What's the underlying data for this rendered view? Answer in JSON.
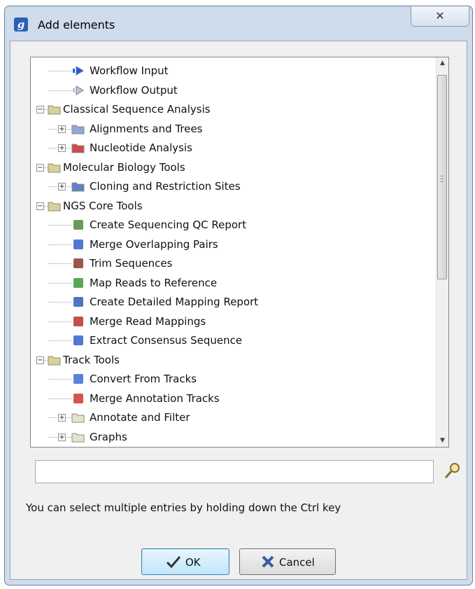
{
  "window": {
    "title": "Add elements",
    "close_glyph": "✕",
    "app_icon_glyph": "g"
  },
  "tree": {
    "rows": [
      {
        "label": "Workflow Input",
        "icon": "workflow-input-icon",
        "level": 1,
        "expander": null
      },
      {
        "label": "Workflow Output",
        "icon": "workflow-output-icon",
        "level": 1,
        "expander": null
      },
      {
        "label": "Classical Sequence Analysis",
        "icon": "folder-chart-icon",
        "level": 0,
        "expander": "−"
      },
      {
        "label": "Alignments and Trees",
        "icon": "alignment-folder-icon",
        "level": 1,
        "expander": "+"
      },
      {
        "label": "Nucleotide Analysis",
        "icon": "nucleotide-folder-icon",
        "level": 1,
        "expander": "+"
      },
      {
        "label": "Molecular Biology Tools",
        "icon": "folder-tools-icon",
        "level": 0,
        "expander": "−"
      },
      {
        "label": "Cloning and Restriction Sites",
        "icon": "cloning-folder-icon",
        "level": 1,
        "expander": "+"
      },
      {
        "label": "NGS Core Tools",
        "icon": "folder-ngs-icon",
        "level": 0,
        "expander": "−"
      },
      {
        "label": "Create Sequencing QC Report",
        "icon": "qc-report-icon",
        "level": 1,
        "expander": null
      },
      {
        "label": "Merge Overlapping Pairs",
        "icon": "merge-pairs-icon",
        "level": 1,
        "expander": null
      },
      {
        "label": "Trim Sequences",
        "icon": "scissors-icon",
        "level": 1,
        "expander": null
      },
      {
        "label": "Map Reads to Reference",
        "icon": "map-reads-icon",
        "level": 1,
        "expander": null
      },
      {
        "label": "Create Detailed Mapping Report",
        "icon": "mapping-report-icon",
        "level": 1,
        "expander": null
      },
      {
        "label": "Merge Read Mappings",
        "icon": "merge-mappings-icon",
        "level": 1,
        "expander": null
      },
      {
        "label": "Extract Consensus Sequence",
        "icon": "consensus-icon",
        "level": 1,
        "expander": null
      },
      {
        "label": "Track Tools",
        "icon": "folder-track-icon",
        "level": 0,
        "expander": "−"
      },
      {
        "label": "Convert From Tracks",
        "icon": "convert-tracks-icon",
        "level": 1,
        "expander": null
      },
      {
        "label": "Merge Annotation Tracks",
        "icon": "merge-annotation-icon",
        "level": 1,
        "expander": null
      },
      {
        "label": "Annotate and Filter",
        "icon": "folder-icon",
        "level": 1,
        "expander": "+"
      },
      {
        "label": "Graphs",
        "icon": "folder-icon",
        "level": 1,
        "expander": "+"
      }
    ]
  },
  "search": {
    "value": "",
    "icon": "search-icon"
  },
  "hint": "You can select multiple entries by holding down the Ctrl key",
  "buttons": {
    "ok": "OK",
    "cancel": "Cancel"
  }
}
